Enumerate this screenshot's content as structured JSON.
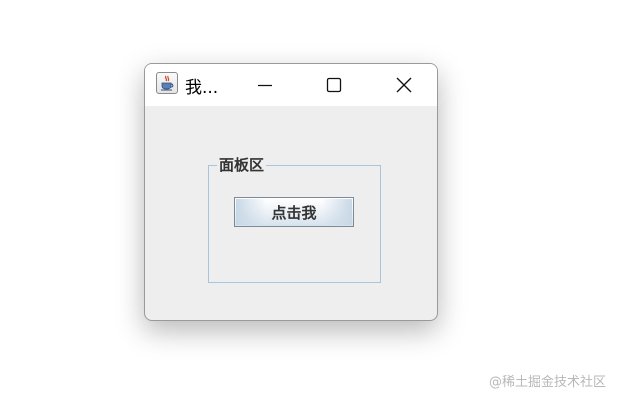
{
  "window": {
    "title": "我...",
    "app_icon": "java-coffee-icon",
    "controls": {
      "minimize_icon": "minimize-icon",
      "maximize_icon": "maximize-icon",
      "close_icon": "close-icon"
    }
  },
  "panel": {
    "legend": "面板区",
    "button_label": "点击我"
  },
  "watermark": "@稀土掘金技术社区",
  "colors": {
    "window_bg": "#eeeeee",
    "titlebar_bg": "#ffffff",
    "panel_border": "#a9c4dd"
  }
}
